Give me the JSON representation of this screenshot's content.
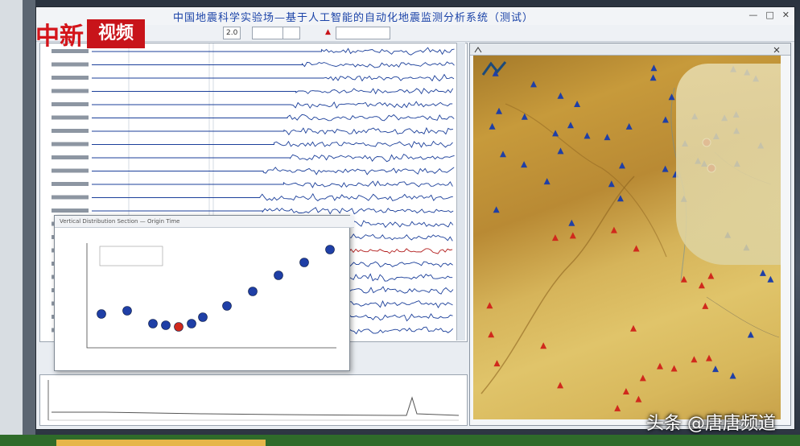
{
  "app": {
    "title": "中国地震科学实验场—基于人工智能的自动化地震监测分析系统（测试）",
    "window_controls": [
      "—",
      "□",
      "✕"
    ]
  },
  "toolbar": {
    "field_value": "2.0",
    "buttons": [
      "▲"
    ]
  },
  "overlay_logo": {
    "red_text": "中新",
    "box_text": "视频"
  },
  "watermark": "头条 @唐唐频道",
  "popup": {
    "title": "Vertical Distribution Section — Origin Time"
  },
  "colors": {
    "title_blue": "#1b43a8",
    "station_blue": "#1f3fa6",
    "station_red": "#d0291c",
    "logo_red": "#c8141a"
  },
  "icons": [
    "minimize-icon",
    "maximize-icon",
    "close-icon",
    "warning-icon",
    "compass-icon"
  ]
}
